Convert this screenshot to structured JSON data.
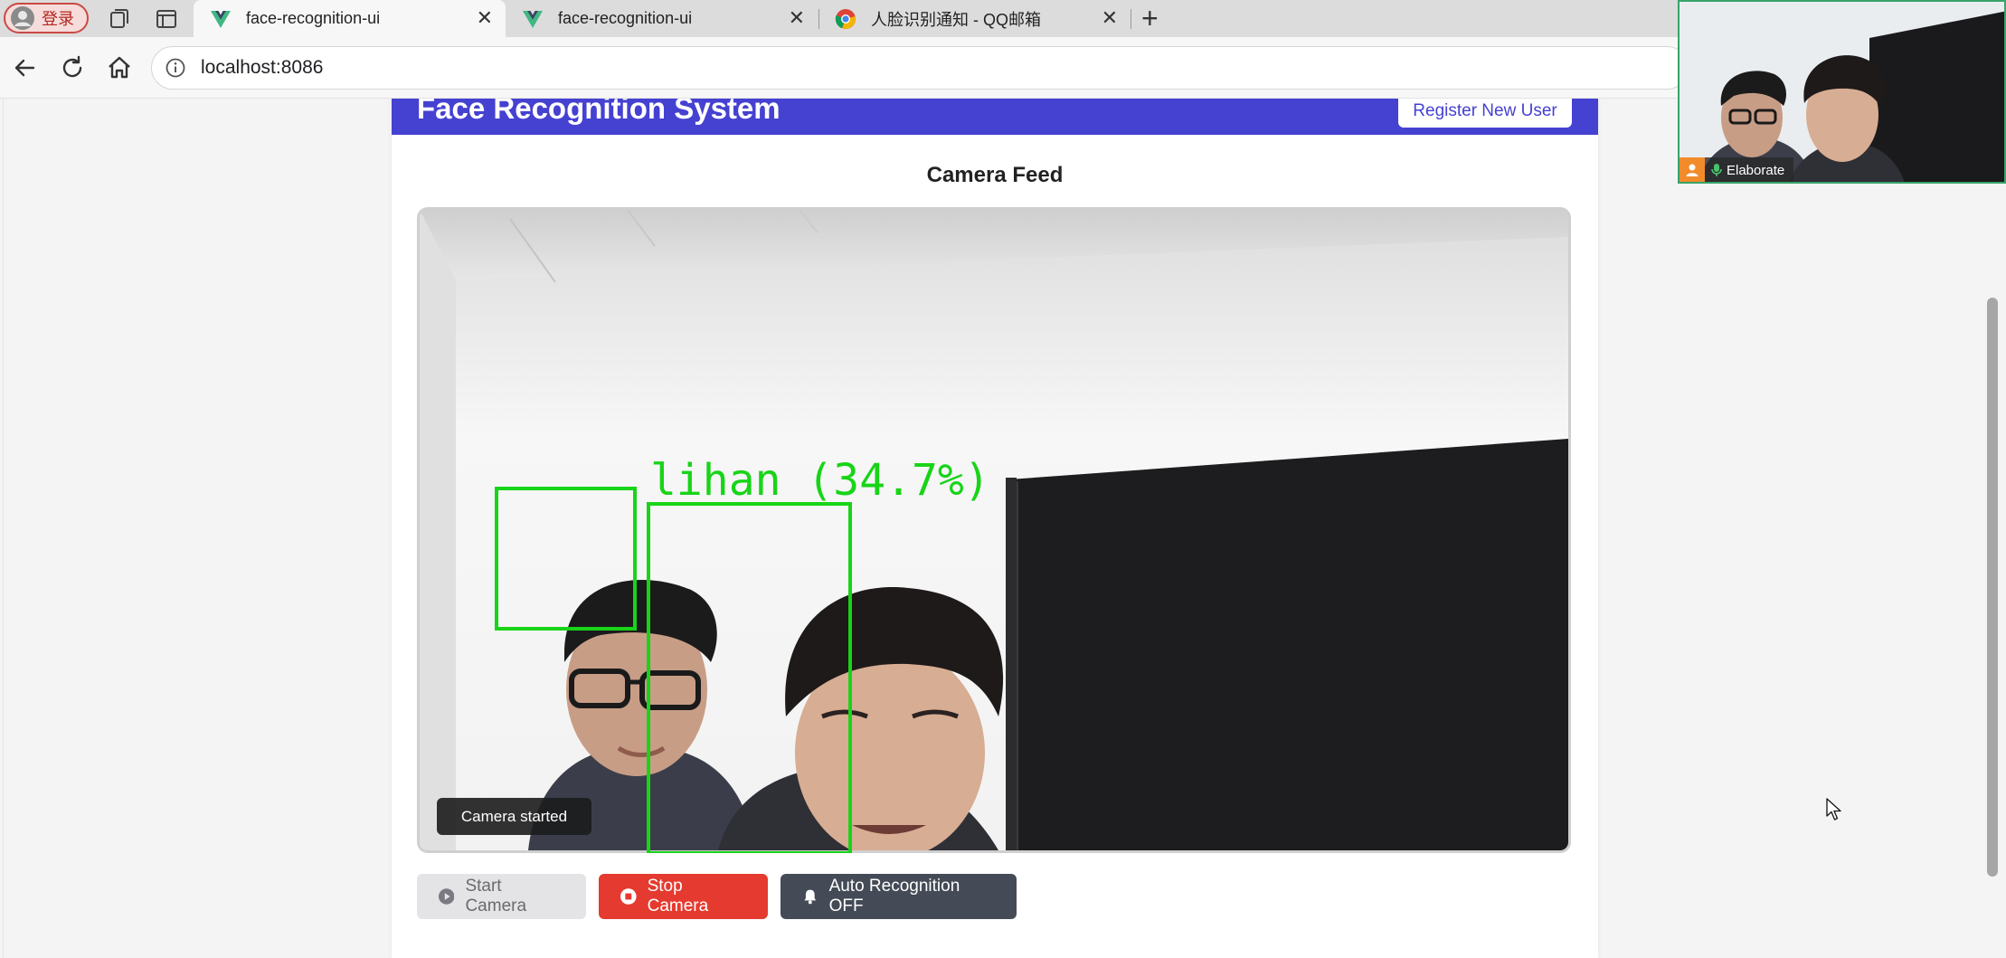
{
  "browser": {
    "profile_label": "登录",
    "tabs": [
      {
        "title": "face-recognition-ui",
        "active": true,
        "favicon": "vue-icon"
      },
      {
        "title": "face-recognition-ui",
        "active": false,
        "favicon": "vue-icon"
      },
      {
        "title": "人脸识别通知 - QQ邮箱",
        "active": false,
        "favicon": "chrome-icon"
      }
    ],
    "url": "localhost:8086"
  },
  "app": {
    "title": "Face Recognition System",
    "register_button": "Register New User",
    "section_title": "Camera Feed",
    "detection_label": "lihan (34.7%)",
    "toast": "Camera started",
    "buttons": {
      "start": "Start Camera",
      "stop": "Stop Camera",
      "auto": "Auto Recognition OFF"
    }
  },
  "video_call": {
    "participant_name": "Elaborate"
  },
  "colors": {
    "header": "#4541d1",
    "stop": "#e53a2f",
    "auto": "#444b57",
    "detection_box": "#18d418"
  }
}
